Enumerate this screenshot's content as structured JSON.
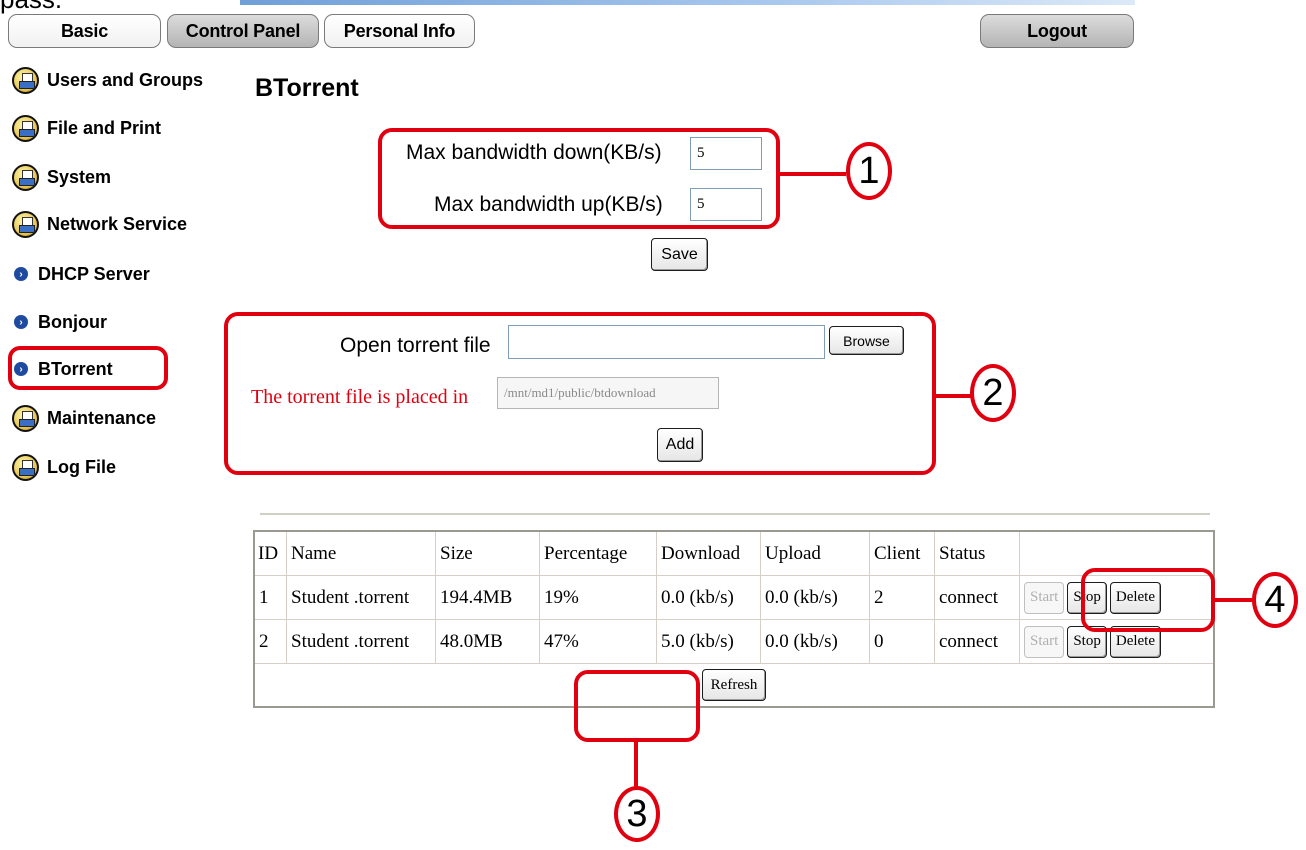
{
  "top_cut_text": "pass.",
  "tabs": {
    "basic": "Basic",
    "control_panel": "Control Panel",
    "personal_info": "Personal Info",
    "logout": "Logout"
  },
  "sidebar": {
    "users_groups": "Users and Groups",
    "file_print": "File and Print",
    "system": "System",
    "network_service": "Network Service",
    "dhcp": "DHCP Server",
    "bonjour": "Bonjour",
    "btorrent": "BTorrent",
    "maintenance": "Maintenance",
    "log_file": "Log File"
  },
  "page_title": "BTorrent",
  "bandwidth": {
    "down_label": "Max bandwidth down(KB/s)",
    "down_value": "5",
    "up_label": "Max bandwidth up(KB/s)",
    "up_value": "5",
    "save": "Save"
  },
  "torrent_file": {
    "open_label": "Open torrent file",
    "open_value": "",
    "browse": "Browse",
    "placed_label": "The torrent file is placed in",
    "placed_value": "/mnt/md1/public/btdownload",
    "add": "Add"
  },
  "table": {
    "headers": {
      "id": "ID",
      "name": "Name",
      "size": "Size",
      "percentage": "Percentage",
      "download": "Download",
      "upload": "Upload",
      "client": "Client",
      "status": "Status"
    },
    "rows": [
      {
        "id": "1",
        "name": "Student .torrent",
        "size": "194.4MB",
        "percentage": "19%",
        "download": "0.0 (kb/s)",
        "upload": "0.0 (kb/s)",
        "client": "2",
        "status": "connect"
      },
      {
        "id": "2",
        "name": "Student .torrent",
        "size": "48.0MB",
        "percentage": "47%",
        "download": "5.0 (kb/s)",
        "upload": "0.0 (kb/s)",
        "client": "0",
        "status": "connect"
      }
    ],
    "start": "Start",
    "stop": "Stop",
    "delete": "Delete",
    "refresh": "Refresh"
  },
  "callouts": {
    "c1": "1",
    "c2": "2",
    "c3": "3",
    "c4": "4"
  },
  "colors": {
    "callout_red": "#e00010",
    "placed_label_red": "#e00010",
    "bullet_blue": "#1e4aa0"
  }
}
